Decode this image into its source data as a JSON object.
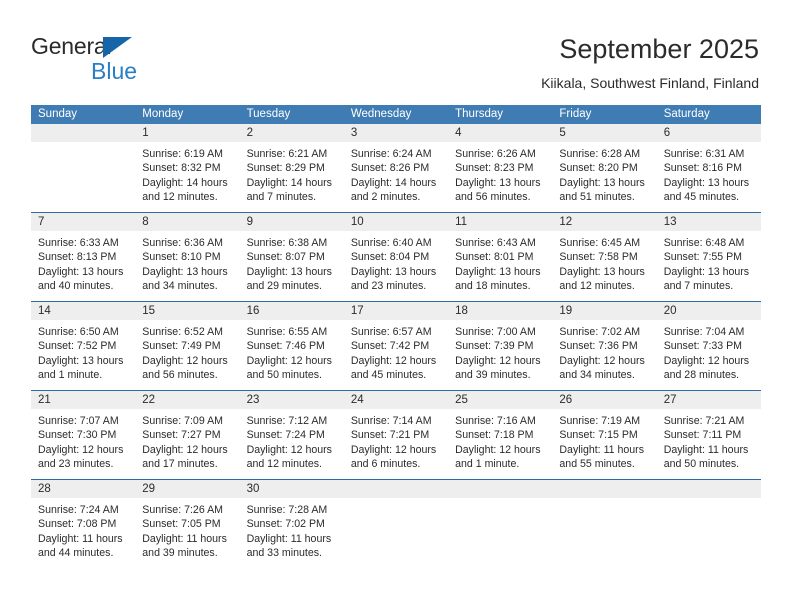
{
  "brand": {
    "name_part1": "General",
    "name_part2": "Blue",
    "triangle_color": "#1565a8",
    "blue_text_color": "#2a7ec4"
  },
  "header": {
    "title": "September 2025",
    "subtitle": "Kiikala, Southwest Finland, Finland"
  },
  "theme": {
    "header_bar_color": "#3f7cb4",
    "week_divider_color": "#2c6aa8",
    "daynum_strip_color": "#eeeeee",
    "text_color": "#2b2b2b"
  },
  "weekdays": [
    "Sunday",
    "Monday",
    "Tuesday",
    "Wednesday",
    "Thursday",
    "Friday",
    "Saturday"
  ],
  "weeks": [
    {
      "days": [
        {
          "num": "",
          "sunrise": "",
          "sunset": "",
          "daylight": ""
        },
        {
          "num": "1",
          "sunrise": "Sunrise: 6:19 AM",
          "sunset": "Sunset: 8:32 PM",
          "daylight": "Daylight: 14 hours and 12 minutes."
        },
        {
          "num": "2",
          "sunrise": "Sunrise: 6:21 AM",
          "sunset": "Sunset: 8:29 PM",
          "daylight": "Daylight: 14 hours and 7 minutes."
        },
        {
          "num": "3",
          "sunrise": "Sunrise: 6:24 AM",
          "sunset": "Sunset: 8:26 PM",
          "daylight": "Daylight: 14 hours and 2 minutes."
        },
        {
          "num": "4",
          "sunrise": "Sunrise: 6:26 AM",
          "sunset": "Sunset: 8:23 PM",
          "daylight": "Daylight: 13 hours and 56 minutes."
        },
        {
          "num": "5",
          "sunrise": "Sunrise: 6:28 AM",
          "sunset": "Sunset: 8:20 PM",
          "daylight": "Daylight: 13 hours and 51 minutes."
        },
        {
          "num": "6",
          "sunrise": "Sunrise: 6:31 AM",
          "sunset": "Sunset: 8:16 PM",
          "daylight": "Daylight: 13 hours and 45 minutes."
        }
      ]
    },
    {
      "days": [
        {
          "num": "7",
          "sunrise": "Sunrise: 6:33 AM",
          "sunset": "Sunset: 8:13 PM",
          "daylight": "Daylight: 13 hours and 40 minutes."
        },
        {
          "num": "8",
          "sunrise": "Sunrise: 6:36 AM",
          "sunset": "Sunset: 8:10 PM",
          "daylight": "Daylight: 13 hours and 34 minutes."
        },
        {
          "num": "9",
          "sunrise": "Sunrise: 6:38 AM",
          "sunset": "Sunset: 8:07 PM",
          "daylight": "Daylight: 13 hours and 29 minutes."
        },
        {
          "num": "10",
          "sunrise": "Sunrise: 6:40 AM",
          "sunset": "Sunset: 8:04 PM",
          "daylight": "Daylight: 13 hours and 23 minutes."
        },
        {
          "num": "11",
          "sunrise": "Sunrise: 6:43 AM",
          "sunset": "Sunset: 8:01 PM",
          "daylight": "Daylight: 13 hours and 18 minutes."
        },
        {
          "num": "12",
          "sunrise": "Sunrise: 6:45 AM",
          "sunset": "Sunset: 7:58 PM",
          "daylight": "Daylight: 13 hours and 12 minutes."
        },
        {
          "num": "13",
          "sunrise": "Sunrise: 6:48 AM",
          "sunset": "Sunset: 7:55 PM",
          "daylight": "Daylight: 13 hours and 7 minutes."
        }
      ]
    },
    {
      "days": [
        {
          "num": "14",
          "sunrise": "Sunrise: 6:50 AM",
          "sunset": "Sunset: 7:52 PM",
          "daylight": "Daylight: 13 hours and 1 minute."
        },
        {
          "num": "15",
          "sunrise": "Sunrise: 6:52 AM",
          "sunset": "Sunset: 7:49 PM",
          "daylight": "Daylight: 12 hours and 56 minutes."
        },
        {
          "num": "16",
          "sunrise": "Sunrise: 6:55 AM",
          "sunset": "Sunset: 7:46 PM",
          "daylight": "Daylight: 12 hours and 50 minutes."
        },
        {
          "num": "17",
          "sunrise": "Sunrise: 6:57 AM",
          "sunset": "Sunset: 7:42 PM",
          "daylight": "Daylight: 12 hours and 45 minutes."
        },
        {
          "num": "18",
          "sunrise": "Sunrise: 7:00 AM",
          "sunset": "Sunset: 7:39 PM",
          "daylight": "Daylight: 12 hours and 39 minutes."
        },
        {
          "num": "19",
          "sunrise": "Sunrise: 7:02 AM",
          "sunset": "Sunset: 7:36 PM",
          "daylight": "Daylight: 12 hours and 34 minutes."
        },
        {
          "num": "20",
          "sunrise": "Sunrise: 7:04 AM",
          "sunset": "Sunset: 7:33 PM",
          "daylight": "Daylight: 12 hours and 28 minutes."
        }
      ]
    },
    {
      "days": [
        {
          "num": "21",
          "sunrise": "Sunrise: 7:07 AM",
          "sunset": "Sunset: 7:30 PM",
          "daylight": "Daylight: 12 hours and 23 minutes."
        },
        {
          "num": "22",
          "sunrise": "Sunrise: 7:09 AM",
          "sunset": "Sunset: 7:27 PM",
          "daylight": "Daylight: 12 hours and 17 minutes."
        },
        {
          "num": "23",
          "sunrise": "Sunrise: 7:12 AM",
          "sunset": "Sunset: 7:24 PM",
          "daylight": "Daylight: 12 hours and 12 minutes."
        },
        {
          "num": "24",
          "sunrise": "Sunrise: 7:14 AM",
          "sunset": "Sunset: 7:21 PM",
          "daylight": "Daylight: 12 hours and 6 minutes."
        },
        {
          "num": "25",
          "sunrise": "Sunrise: 7:16 AM",
          "sunset": "Sunset: 7:18 PM",
          "daylight": "Daylight: 12 hours and 1 minute."
        },
        {
          "num": "26",
          "sunrise": "Sunrise: 7:19 AM",
          "sunset": "Sunset: 7:15 PM",
          "daylight": "Daylight: 11 hours and 55 minutes."
        },
        {
          "num": "27",
          "sunrise": "Sunrise: 7:21 AM",
          "sunset": "Sunset: 7:11 PM",
          "daylight": "Daylight: 11 hours and 50 minutes."
        }
      ]
    },
    {
      "days": [
        {
          "num": "28",
          "sunrise": "Sunrise: 7:24 AM",
          "sunset": "Sunset: 7:08 PM",
          "daylight": "Daylight: 11 hours and 44 minutes."
        },
        {
          "num": "29",
          "sunrise": "Sunrise: 7:26 AM",
          "sunset": "Sunset: 7:05 PM",
          "daylight": "Daylight: 11 hours and 39 minutes."
        },
        {
          "num": "30",
          "sunrise": "Sunrise: 7:28 AM",
          "sunset": "Sunset: 7:02 PM",
          "daylight": "Daylight: 11 hours and 33 minutes."
        },
        {
          "num": "",
          "sunrise": "",
          "sunset": "",
          "daylight": ""
        },
        {
          "num": "",
          "sunrise": "",
          "sunset": "",
          "daylight": ""
        },
        {
          "num": "",
          "sunrise": "",
          "sunset": "",
          "daylight": ""
        },
        {
          "num": "",
          "sunrise": "",
          "sunset": "",
          "daylight": ""
        }
      ]
    }
  ]
}
